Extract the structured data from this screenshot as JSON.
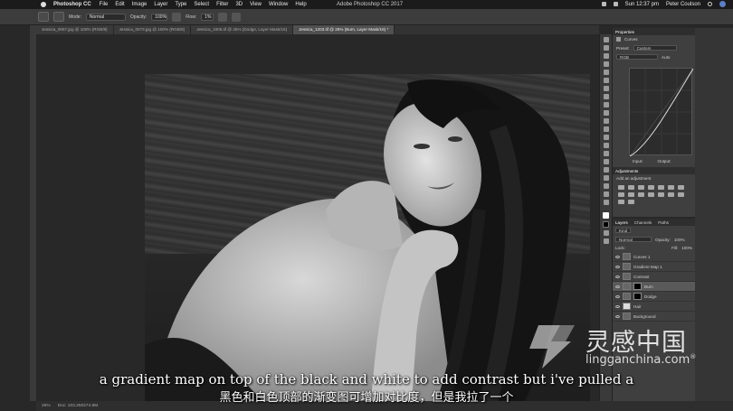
{
  "menubar": {
    "app_name": "Photoshop CC",
    "items": [
      "File",
      "Edit",
      "Image",
      "Layer",
      "Type",
      "Select",
      "Filter",
      "3D",
      "View",
      "Window",
      "Help"
    ],
    "window_title": "Adobe Photoshop CC 2017",
    "clock": "Sun 12:37 pm",
    "user": "Peter Coulson"
  },
  "options_bar": {
    "mode_label": "Mode:",
    "mode_value": "Normal",
    "opacity_label": "Opacity:",
    "opacity_value": "100%",
    "flow_label": "Flow:",
    "flow_value": "1%"
  },
  "tabs": [
    "Jessica_0067.jpg @ 100% (RGB/8)",
    "Jessica_0073.jpg @ 100% (RGB/8)",
    "Jessica_1006.tif @ 25% (Dodge, Layer Mask/16)",
    "Jessica_1203.tif @ 25% (Burn, Layer Mask/16) *"
  ],
  "properties": {
    "tab": "Properties",
    "title": "Curves",
    "preset_label": "Preset:",
    "preset_value": "Custom",
    "channel_value": "RGB",
    "auto_button": "Auto",
    "input_label": "Input:",
    "output_label": "Output:"
  },
  "adjustments": {
    "tab": "Adjustments",
    "subtitle": "Add an adjustment"
  },
  "layers_panel": {
    "tabs": [
      "Layers",
      "Channels",
      "Paths"
    ],
    "kind_filter": "Kind",
    "blend_mode": "Normal",
    "opacity_label": "Opacity:",
    "opacity_value": "100%",
    "lock_label": "Lock:",
    "fill_label": "Fill:",
    "fill_value": "100%",
    "layers": [
      {
        "name": "Curves 1",
        "selected": false,
        "mask": false
      },
      {
        "name": "Gradient Map 1",
        "selected": false,
        "mask": false
      },
      {
        "name": "Contrast",
        "selected": false,
        "mask": false
      },
      {
        "name": "Burn",
        "selected": true,
        "mask": true
      },
      {
        "name": "Dodge",
        "selected": false,
        "mask": true
      },
      {
        "name": "Hair",
        "selected": false,
        "mask": false
      },
      {
        "name": "Background",
        "selected": false,
        "mask": false
      }
    ]
  },
  "status_bar": {
    "zoom": "25%",
    "doc_info": "Doc: 103.2M/274.9M"
  },
  "subtitles": {
    "english": "a gradient map on top of the black and white to add contrast but i've pulled a",
    "chinese": "黑色和白色顶部的渐变图可增加对比度，但是我拉了一个"
  },
  "watermark": {
    "title": "灵感中国",
    "url": "lingganchina.com",
    "registered_mark": "®"
  },
  "colors": {
    "ui_dark": "#282828",
    "panel": "#3f3f3f",
    "subtitle": "#ffffff"
  }
}
